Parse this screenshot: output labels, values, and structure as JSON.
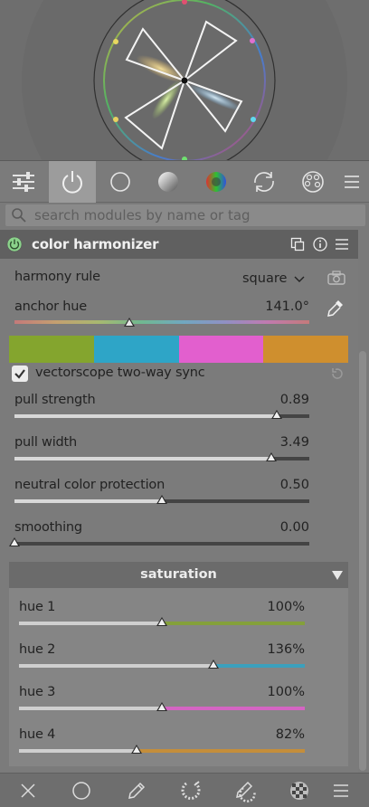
{
  "search": {
    "placeholder": "search modules by name or tag"
  },
  "module": {
    "title": "color harmonizer"
  },
  "harmony_rule": {
    "label": "harmony rule",
    "value": "square"
  },
  "anchor_hue": {
    "label": "anchor hue",
    "value": "141.0°",
    "fraction": 0.39
  },
  "swatches": [
    "#84a52e",
    "#2ea5c7",
    "#e25fce",
    "#cf8f2e"
  ],
  "vectorscope_sync": {
    "label": "vectorscope two-way sync",
    "checked": true
  },
  "sliders": [
    {
      "label": "pull strength",
      "value": "0.89",
      "fraction": 0.89
    },
    {
      "label": "pull width",
      "value": "3.49",
      "fraction": 0.87
    },
    {
      "label": "neutral color protection",
      "value": "0.50",
      "fraction": 0.5
    },
    {
      "label": "smoothing",
      "value": "0.00",
      "fraction": 0.0
    }
  ],
  "saturation": {
    "title": "saturation",
    "hues": [
      {
        "label": "hue 1",
        "value": "100%",
        "fraction": 0.5,
        "color": "#84a52e"
      },
      {
        "label": "hue 2",
        "value": "136%",
        "fraction": 0.68,
        "color": "#2ea5c7"
      },
      {
        "label": "hue 3",
        "value": "100%",
        "fraction": 0.5,
        "color": "#e25fce"
      },
      {
        "label": "hue 4",
        "value": "82%",
        "fraction": 0.41,
        "color": "#cf8f2e"
      }
    ]
  },
  "tabs": [
    "sliders-icon",
    "power-icon",
    "circle-icon",
    "sphere-icon",
    "rgb-wheel-icon",
    "refresh-icon",
    "palette-icon",
    "menu-icon"
  ],
  "bottom_tools": [
    "close-icon",
    "circle-icon",
    "pencil-icon",
    "brush-icon",
    "gradient-brush-icon",
    "checker-icon",
    "menu-icon"
  ]
}
